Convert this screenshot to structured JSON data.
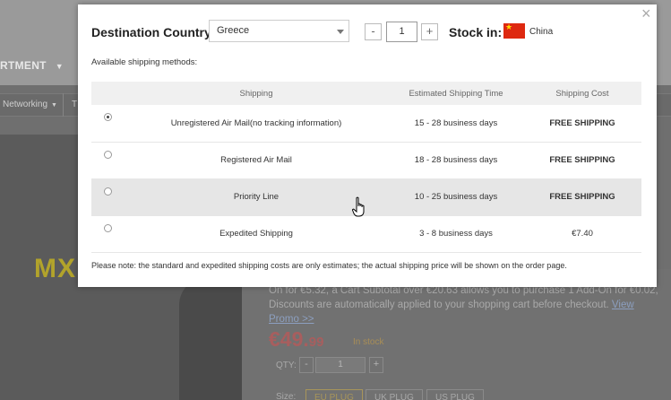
{
  "background": {
    "department": "RTMENT",
    "breadcrumb_networking": "Networking",
    "breadcrumb_next": "T",
    "product_logo": "MX",
    "addon_text": "On for €5.32, a Cart Subtotal over €20.63 allows you to purchase 1 Add-On for €0.02, Discounts are automatically applied to your shopping cart before checkout.",
    "addon_link": "View Promo >>",
    "price_main": "€49.",
    "price_cents": "99",
    "stock_status": "In stock",
    "qty_label": "QTY:",
    "qty_minus": "-",
    "qty_value": "1",
    "qty_plus": "+",
    "size_label": "Size:",
    "size_options": [
      "EU PLUG",
      "UK PLUG",
      "US PLUG"
    ]
  },
  "modal": {
    "close": "×",
    "destination_label": "Destination Country:",
    "destination_value": "Greece",
    "qty_minus": "-",
    "qty_value": "1",
    "qty_plus": "+",
    "stock_label": "Stock in:",
    "stock_country": "China",
    "available_label": "Available shipping methods:",
    "table": {
      "headers": [
        "Shipping",
        "Estimated Shipping Time",
        "Shipping Cost"
      ],
      "rows": [
        {
          "name": "Unregistered Air Mail(no tracking information)",
          "time": "15 - 28 business days",
          "cost": "FREE SHIPPING",
          "selected": true
        },
        {
          "name": "Registered Air Mail",
          "time": "18 - 28 business days",
          "cost": "FREE SHIPPING",
          "selected": false
        },
        {
          "name": "Priority Line",
          "time": "10 - 25 business days",
          "cost": "FREE SHIPPING",
          "selected": false
        },
        {
          "name": "Expedited Shipping",
          "time": "3 - 8 business days",
          "cost": "€7.40",
          "selected": false
        }
      ]
    },
    "note": "Please note: the standard and expedited shipping costs are only estimates; the actual shipping price will be shown on the order page."
  },
  "colors": {
    "cost_red": "#c0282d",
    "flag_red": "#de2910",
    "flag_star": "#ffde00"
  }
}
